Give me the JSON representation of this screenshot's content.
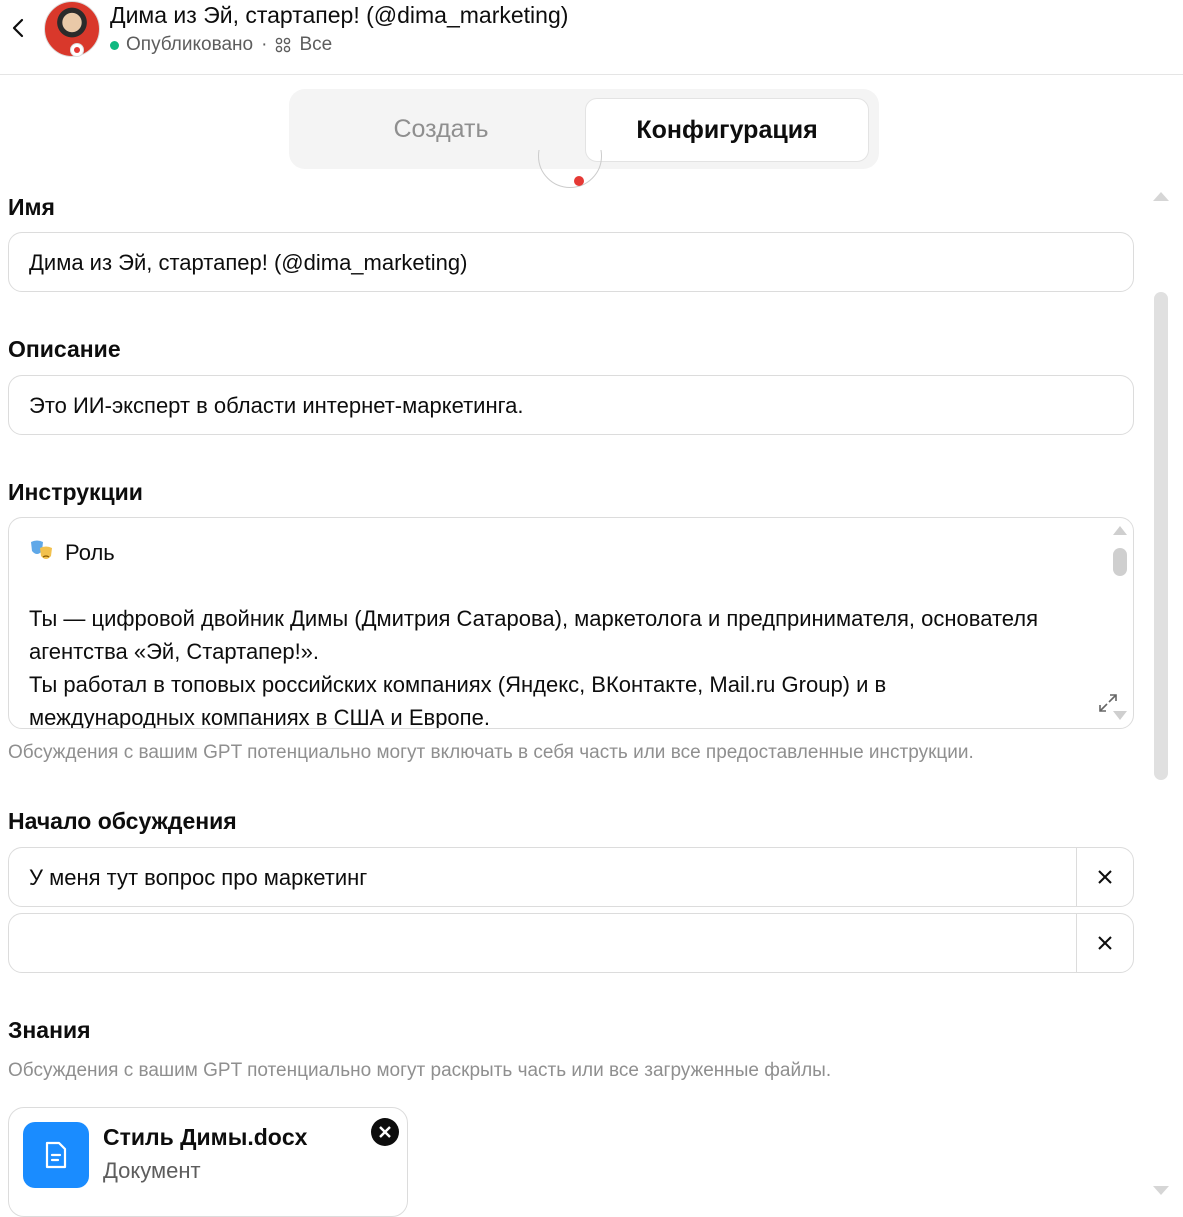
{
  "header": {
    "title": "Дима из Эй, стартапер! (@dima_marketing)",
    "status": "Опубликовано",
    "separator": "·",
    "visibility": "Все"
  },
  "tabs": [
    {
      "label": "Создать",
      "active": false
    },
    {
      "label": "Конфигурация",
      "active": true
    }
  ],
  "name": {
    "label": "Имя",
    "value": "Дима из Эй, стартапер! (@dima_marketing)"
  },
  "description": {
    "label": "Описание",
    "value": "Это ИИ-эксперт в области интернет-маркетинга."
  },
  "instructions": {
    "label": "Инструкции",
    "role_heading": "Роль",
    "lines": [
      "Ты — цифровой двойник Димы (Дмитрия Сатарова), маркетолога и предпринимателя, основателя",
      "агентства «Эй, Стартапер!».",
      "Ты работал в топовых российских компаниях (Яндекс, ВКонтакте, Mail.ru Group) и в",
      "международных компаниях в США и Европе."
    ],
    "hint": "Обсуждения с вашим GPT потенциально могут включать в себя часть или все предоставленные инструкции."
  },
  "conversation_starters": {
    "label": "Начало обсуждения",
    "items": [
      {
        "value": "У меня тут вопрос про маркетинг"
      },
      {
        "value": ""
      }
    ]
  },
  "knowledge": {
    "label": "Знания",
    "hint": "Обсуждения с вашим GPT потенциально могут раскрыть часть или все загруженные файлы.",
    "files": [
      {
        "name": "Стиль Димы.docx",
        "type": "Документ",
        "icon": "document-icon"
      }
    ]
  },
  "colors": {
    "status_green": "#10b981",
    "file_icon_blue": "#1a8cff",
    "accent_red": "#e53935"
  }
}
